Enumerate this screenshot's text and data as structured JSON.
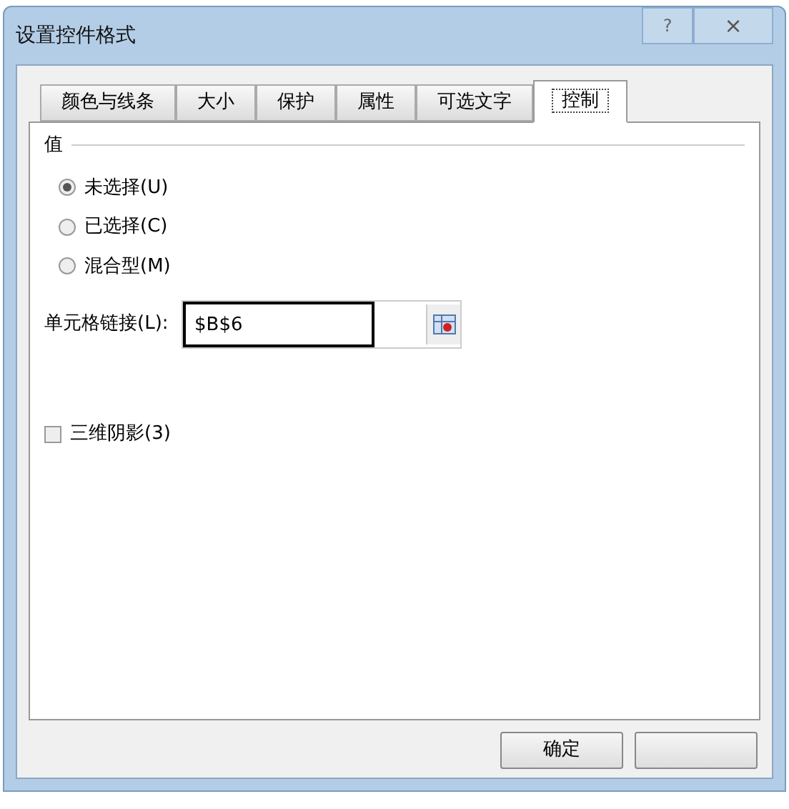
{
  "window": {
    "title": "设置控件格式",
    "help": "?",
    "close": "×"
  },
  "tabs": [
    {
      "label": "颜色与线条",
      "selected": false
    },
    {
      "label": "大小",
      "selected": false
    },
    {
      "label": "保护",
      "selected": false
    },
    {
      "label": "属性",
      "selected": false
    },
    {
      "label": "可选文字",
      "selected": false
    },
    {
      "label": "控制",
      "selected": true
    }
  ],
  "value_group": {
    "title": "值",
    "options": [
      {
        "label": "未选择(U)",
        "selected": true
      },
      {
        "label": "已选择(C)",
        "selected": false
      },
      {
        "label": "混合型(M)",
        "selected": false
      }
    ]
  },
  "cell_link": {
    "label": "单元格链接(L):",
    "value": "$B$6"
  },
  "shading_3d": {
    "label": "三维阴影(3)",
    "checked": false
  },
  "buttons": [
    {
      "kind": "text",
      "label": "确定"
    },
    {
      "kind": "blank"
    }
  ]
}
